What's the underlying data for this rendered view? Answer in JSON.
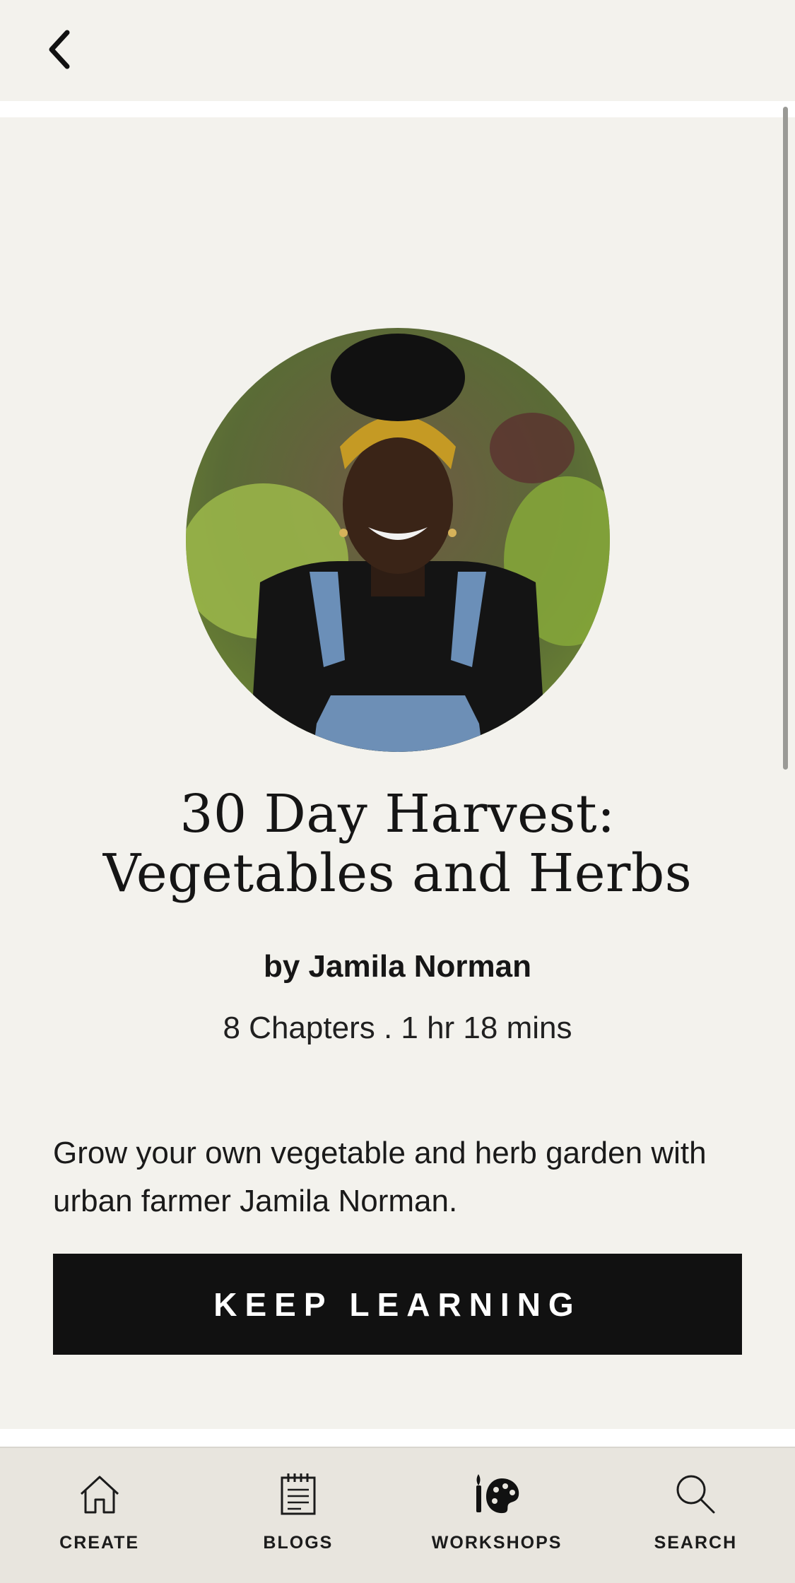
{
  "course": {
    "title": "30 Day Harvest: Vegetables and Herbs",
    "author": "by Jamila Norman",
    "meta": "8 Chapters . 1 hr 18 mins",
    "description": "Grow your own vegetable and herb garden with urban farmer Jamila Norman.",
    "cta_label": "KEEP LEARNING"
  },
  "tabs": [
    {
      "label": "CREATE",
      "icon": "home-icon"
    },
    {
      "label": "BLOGS",
      "icon": "notepad-icon"
    },
    {
      "label": "WORKSHOPS",
      "icon": "palette-icon"
    },
    {
      "label": "SEARCH",
      "icon": "search-icon"
    }
  ],
  "colors": {
    "background": "#f3f2ed",
    "tabbar": "#e8e5de",
    "button": "#111111"
  }
}
